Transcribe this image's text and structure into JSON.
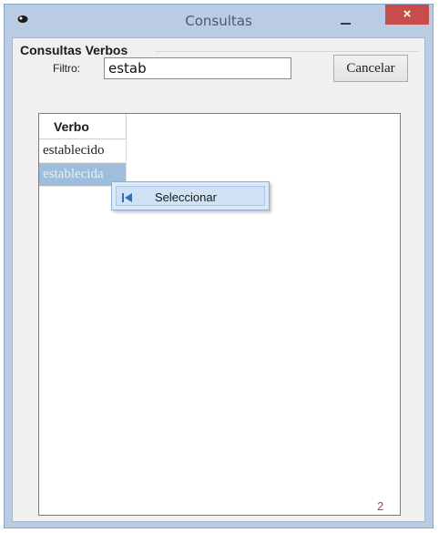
{
  "window": {
    "title": "Consultas",
    "close_label": "×"
  },
  "group": {
    "title": "Consultas Verbos"
  },
  "filter": {
    "label": "Filtro:",
    "value": "estab"
  },
  "buttons": {
    "cancel_label": "Cancelar"
  },
  "grid": {
    "column_header": "Verbo",
    "rows": [
      "establecido",
      "establecida"
    ],
    "selected_row": 1
  },
  "context_menu": {
    "items": [
      {
        "label": "Seleccionar",
        "icon": "select-arrow-icon"
      }
    ]
  },
  "status": {
    "count": "2"
  },
  "colors": {
    "selection": "#9fbedc",
    "close_button": "#c74c4c",
    "count_text": "#d13b3b"
  }
}
